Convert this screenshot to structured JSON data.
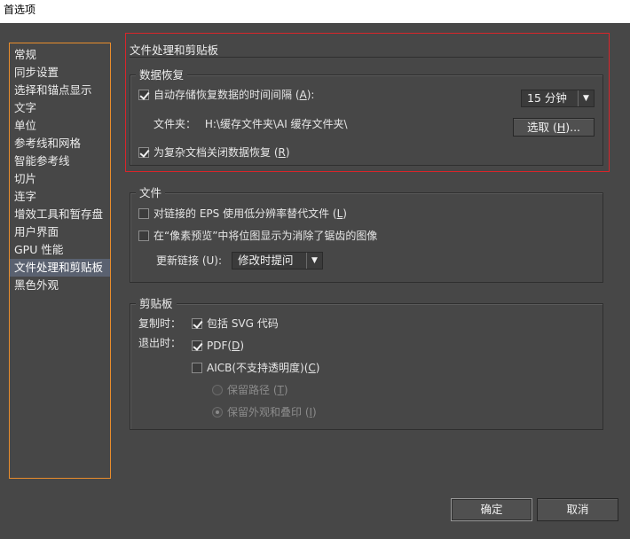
{
  "window": {
    "title": "首选项"
  },
  "sidebar": {
    "items": [
      {
        "label": "常规"
      },
      {
        "label": "同步设置"
      },
      {
        "label": "选择和锚点显示"
      },
      {
        "label": "文字"
      },
      {
        "label": "单位"
      },
      {
        "label": "参考线和网格"
      },
      {
        "label": "智能参考线"
      },
      {
        "label": "切片"
      },
      {
        "label": "连字"
      },
      {
        "label": "增效工具和暂存盘"
      },
      {
        "label": "用户界面"
      },
      {
        "label": "GPU 性能"
      },
      {
        "label": "文件处理和剪贴板",
        "selected": true
      },
      {
        "label": "黑色外观"
      }
    ]
  },
  "main": {
    "section_title": "文件处理和剪贴板",
    "data_recovery": {
      "title": "数据恢复",
      "autosave_checked": true,
      "autosave_label_pre": "自动存储恢复数据的时间间隔 (",
      "autosave_key": "A",
      "autosave_label_post": "):",
      "interval_value": "15 分钟",
      "folder_label": "文件夹：",
      "folder_path": "H:\\缓存文件夹\\AI 缓存文件夹\\",
      "choose_pre": "选取 (",
      "choose_key": "H",
      "choose_post": ")...",
      "complex_checked": true,
      "complex_label_pre": "为复杂文档关闭数据恢复 (",
      "complex_key": "R",
      "complex_label_post": ")"
    },
    "files": {
      "title": "文件",
      "lowres_checked": false,
      "lowres_label_pre": "对链接的 EPS 使用低分辨率替代文件 (",
      "lowres_key": "L",
      "lowres_label_post": ")",
      "antialias_checked": false,
      "antialias_label": "在“像素预览”中将位图显示为消除了锯齿的图像",
      "update_links_label": "更新链接 (U):",
      "update_links_value": "修改时提问"
    },
    "clipboard": {
      "title": "剪贴板",
      "copy_label": "复制时：",
      "include_svg_checked": true,
      "include_svg_label": "包括 SVG 代码",
      "quit_label": "退出时：",
      "pdf_checked": true,
      "pdf_label_pre": "PDF(",
      "pdf_key": "D",
      "pdf_label_post": ")",
      "aicb_checked": false,
      "aicb_label_pre": "AICB(不支持透明度)(",
      "aicb_key": "C",
      "aicb_label_post": ")",
      "preserve_paths_label_pre": "保留路径 (",
      "preserve_paths_key": "T",
      "preserve_paths_label_post": ")",
      "preserve_appearance_label_pre": "保留外观和叠印 (",
      "preserve_appearance_key": "I",
      "preserve_appearance_label_post": ")",
      "selected_option": "preserve_appearance"
    }
  },
  "footer": {
    "ok_label": "确定",
    "cancel_label": "取消"
  },
  "colors": {
    "background": "#474747",
    "sidebar_border": "#e98d2c",
    "selected_item": "#5a6170",
    "highlight_frame": "#d9252a"
  }
}
